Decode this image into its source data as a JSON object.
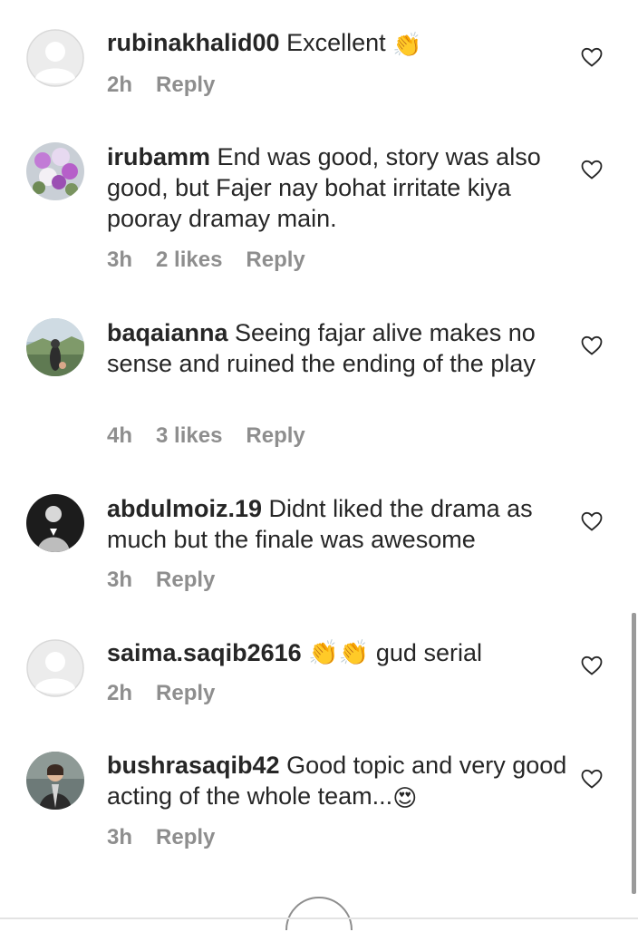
{
  "comments": [
    {
      "username": "rubinakhalid00",
      "text": " Excellent ",
      "emoji": "👏",
      "time": "2h",
      "likes": "",
      "reply_label": "Reply",
      "avatar": "default-avatar"
    },
    {
      "username": "irubamm",
      "text": " End was good, story was also good, but Fajer nay bohat irritate kiya pooray dramay main.",
      "emoji": "",
      "time": "3h",
      "likes": "2 likes",
      "reply_label": "Reply",
      "avatar": "flowers-photo"
    },
    {
      "username": "baqaianna",
      "text": " Seeing fajar alive makes no sense and ruined the ending of the play",
      "emoji": "",
      "time": "4h",
      "likes": "3 likes",
      "reply_label": "Reply",
      "avatar": "landscape-photo"
    },
    {
      "username": "abdulmoiz.19",
      "text": " Didnt liked the drama as much but the finale was awesome",
      "emoji": "",
      "time": "3h",
      "likes": "",
      "reply_label": "Reply",
      "avatar": "person-photo-bw"
    },
    {
      "username": "saima.saqib2616",
      "text": " 👏👏 gud serial",
      "emoji": "",
      "time": "2h",
      "likes": "",
      "reply_label": "Reply",
      "avatar": "default-avatar"
    },
    {
      "username": "bushrasaqib42",
      "text": " Good topic and very good acting of the whole team...",
      "emoji": "😍",
      "time": "3h",
      "likes": "",
      "reply_label": "Reply",
      "avatar": "person-photo-color"
    }
  ],
  "icons": {
    "like": "heart-outline-icon",
    "load_more": "plus-circle-icon"
  },
  "colors": {
    "text": "#262626",
    "meta": "#8e8e8e",
    "avatar_default_bg": "#dbdbdb",
    "heart_stroke": "#262626"
  }
}
